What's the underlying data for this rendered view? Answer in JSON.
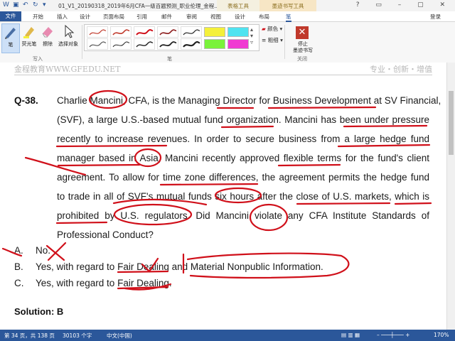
{
  "titlebar": {
    "document_title": "01_V1_20190318_2019年6月CFA一级百题预测_职业伦理_金程...",
    "contextual_tab_1": "表格工具",
    "contextual_tab_2": "墨迹书写工具"
  },
  "tabs": [
    "文件",
    "开始",
    "插入",
    "设计",
    "页面布局",
    "引用",
    "邮件",
    "审阅",
    "视图",
    "设计",
    "布局",
    "笔"
  ],
  "login": "登录",
  "ribbon": {
    "write_group": {
      "label": "写入",
      "buttons": [
        "笔",
        "荧光笔",
        "擦除",
        "选择对象"
      ]
    },
    "pens_group_label": "笔",
    "color_label": "颜色",
    "thickness_label": "粗细",
    "close_group": {
      "label": "关闭",
      "stop_button": "停止\n墨迹书写"
    },
    "highlighter_colors": [
      "#f4f03a",
      "#4fe3f0",
      "#f03ad2",
      "#7af23a",
      "#bcbcbc",
      "#f03ad2"
    ]
  },
  "page_header": {
    "left": "金程教育WWW.GFEDU.NET",
    "right": "专业・创新・增值"
  },
  "question": {
    "number": "Q-38.",
    "lines": [
      "Charlie Mancini, CFA, is the Managing Director for Business Development at SV Financial,",
      "(SVF), a large U.S.-based mutual fund organization. Mancini has been under pressure",
      "recently to increase revenues. In order to secure business from a large hedge fund",
      "manager based in Asia, Mancini recently approved flexible terms for the fund's client",
      "agreement. To allow for time zone differences, the agreement permits the hedge fund",
      "to trade in all of SVF's mutual funds six hours after the close of U.S. markets, which is",
      "prohibited by U.S. regulators. Did Mancini violate any CFA Institute Standards of",
      "Professional Conduct?"
    ]
  },
  "options": [
    {
      "key": "A.",
      "text": "No."
    },
    {
      "key": "B.",
      "text": "Yes, with regard to Fair Dealing and Material Nonpublic Information."
    },
    {
      "key": "C.",
      "text": "Yes, with regard to Fair Dealing."
    }
  ],
  "solution": "Solution: B",
  "statusbar": {
    "page": "第 34 页，共 138 页",
    "words": "30103 个字",
    "language": "中文(中国)",
    "zoom": "170%"
  },
  "colors": {
    "accent": "#2b579a",
    "ink": "#d0101a",
    "header_gray": "#b8b8b8"
  }
}
